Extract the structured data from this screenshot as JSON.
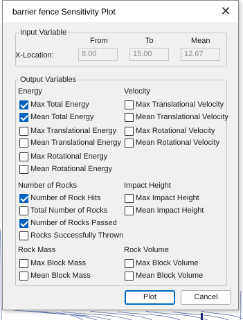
{
  "window": {
    "title": "barrier fence Sensitivity Plot",
    "close_glyph": "✕"
  },
  "input_variable": {
    "legend": "Input Variable",
    "headers": {
      "from": "From",
      "to": "To",
      "mean": "Mean"
    },
    "label": "X-Location:",
    "from": "8.00",
    "to": "15.00",
    "mean": "12.67"
  },
  "output_variables": {
    "legend": "Output Variables",
    "energy": {
      "title": "Energy",
      "items": [
        {
          "label": "Max Total Energy",
          "checked": true
        },
        {
          "label": "Mean Total Energy",
          "checked": true
        },
        {
          "label": "Max Translational Energy",
          "checked": false
        },
        {
          "label": "Mean Translational Energy",
          "checked": false
        },
        {
          "label": "Max Rotational Energy",
          "checked": false
        },
        {
          "label": "Mean Rotational Energy",
          "checked": false
        }
      ]
    },
    "velocity": {
      "title": "Velocity",
      "items": [
        {
          "label": "Max Translational Velocity",
          "checked": false
        },
        {
          "label": "Mean Translational Velocity",
          "checked": false
        },
        {
          "label": "Max Rotational Velocity",
          "checked": false
        },
        {
          "label": "Mean Rotational Velocity",
          "checked": false
        }
      ]
    },
    "rocks": {
      "title": "Number of Rocks",
      "items": [
        {
          "label": "Number of Rock Hits",
          "checked": true
        },
        {
          "label": "Total Number of Rocks",
          "checked": false
        },
        {
          "label": "Number of Rocks Passed",
          "checked": true
        },
        {
          "label": "Rocks Successfully Thrown",
          "checked": false
        }
      ]
    },
    "impact": {
      "title": "Impact Height",
      "items": [
        {
          "label": "Max Impact Height",
          "checked": false
        },
        {
          "label": "Mean Impact Height",
          "checked": false
        }
      ]
    },
    "mass": {
      "title": "Rock Mass",
      "items": [
        {
          "label": "Max Block Mass",
          "checked": false
        },
        {
          "label": "Mean Block Mass",
          "checked": false
        }
      ]
    },
    "volume": {
      "title": "Rock Volume",
      "items": [
        {
          "label": "Max Block Volume",
          "checked": false
        },
        {
          "label": "Mean Block Volume",
          "checked": false
        }
      ]
    }
  },
  "buttons": {
    "plot": "Plot",
    "cancel": "Cancel"
  },
  "colors": {
    "check_accent": "#0060c0",
    "default_button_border": "#0067c0"
  }
}
